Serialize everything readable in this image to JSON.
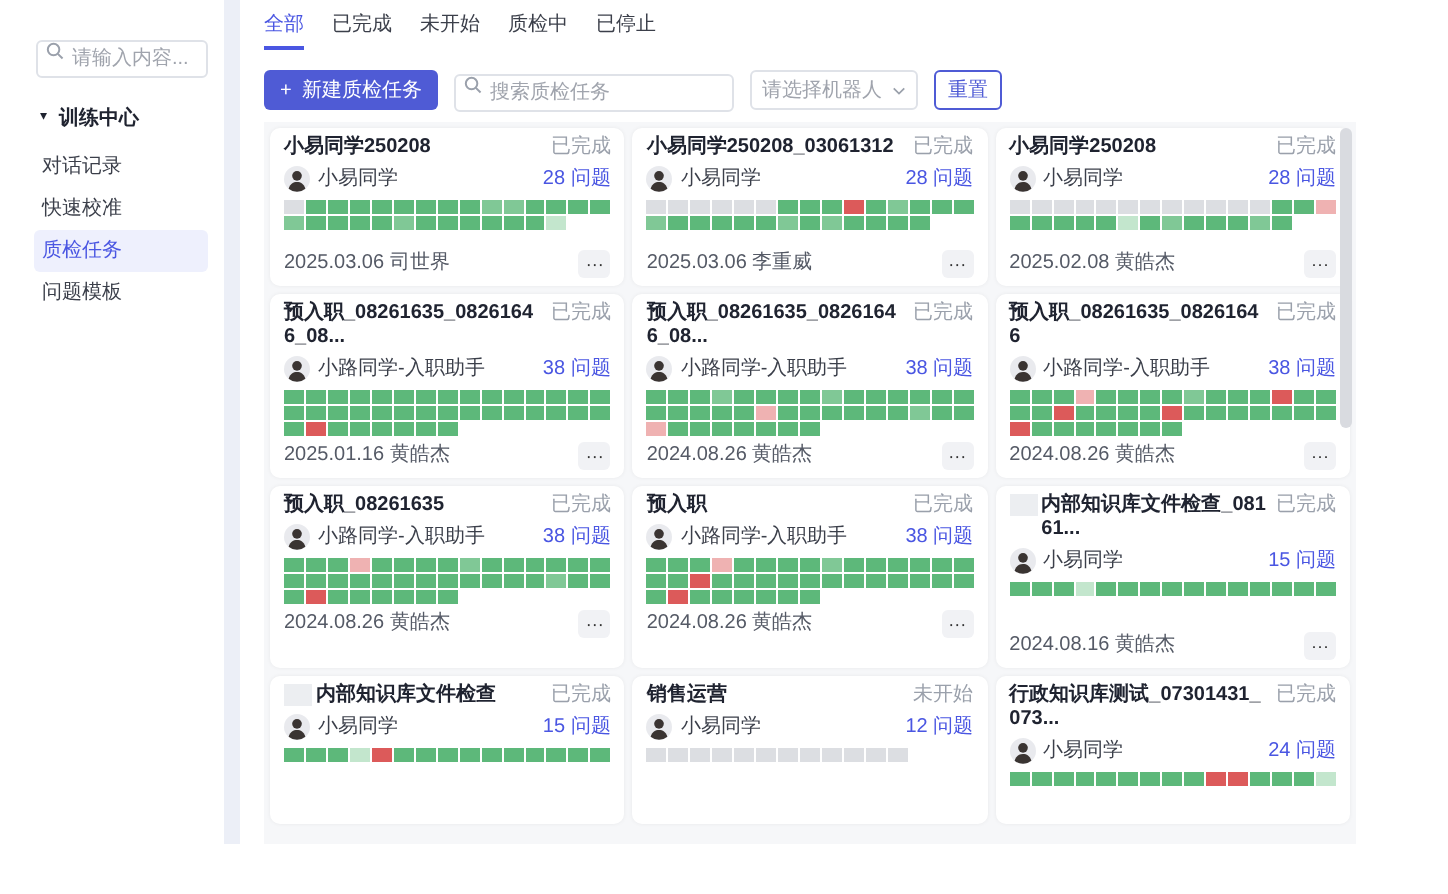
{
  "sidebar": {
    "search": {
      "placeholder": "请输入内容..."
    },
    "group": {
      "icon": "▾",
      "label": "训练中心",
      "expanded": true
    },
    "items": [
      {
        "label": "对话记录",
        "selected": false
      },
      {
        "label": "快速校准",
        "selected": false
      },
      {
        "label": "质检任务",
        "selected": true
      },
      {
        "label": "问题模板",
        "selected": false
      }
    ]
  },
  "tabs": [
    {
      "label": "全部",
      "selected": true
    },
    {
      "label": "已完成",
      "selected": false
    },
    {
      "label": "未开始",
      "selected": false
    },
    {
      "label": "质检中",
      "selected": false
    },
    {
      "label": "已停止",
      "selected": false
    }
  ],
  "toolbar": {
    "new_button": {
      "icon": "+",
      "label": "新建质检任务"
    },
    "search": {
      "placeholder": "搜索质检任务"
    },
    "robot_select": {
      "placeholder": "请选择机器人"
    },
    "reset_button": "重置"
  },
  "cards": [
    {
      "title": "小易同学250208",
      "redacted": false,
      "status": "已完成",
      "user": "小易同学",
      "questions": "28 问题",
      "date": "2025.03.06",
      "owner": "司世界",
      "more": "···",
      "cells": [
        {
          "color": "#dcdee2"
        },
        {
          "color": "#5db87a"
        },
        {
          "color": "#5db87a"
        },
        {
          "color": "#5db87a"
        },
        {
          "color": "#5db87a"
        },
        {
          "color": "#5db87a"
        },
        {
          "color": "#5db87a"
        },
        {
          "color": "#5db87a"
        },
        {
          "color": "#5db87a"
        },
        {
          "color": "#80c896"
        },
        {
          "color": "#80c896"
        },
        {
          "color": "#5db87a"
        },
        {
          "color": "#5db87a"
        },
        {
          "color": "#5db87a"
        },
        {
          "color": "#5db87a"
        },
        {
          "color": "#80c896"
        },
        {
          "color": "#5db87a"
        },
        {
          "color": "#5db87a"
        },
        {
          "color": "#5db87a"
        },
        {
          "color": "#5db87a"
        },
        {
          "color": "#80c896"
        },
        {
          "color": "#5db87a"
        },
        {
          "color": "#5db87a"
        },
        {
          "color": "#5db87a"
        },
        {
          "color": "#5db87a"
        },
        {
          "color": "#5db87a"
        },
        {
          "color": "#5db87a"
        },
        {
          "color": "#c3e6cd"
        }
      ]
    },
    {
      "title": "小易同学250208_03061312",
      "redacted": false,
      "status": "已完成",
      "user": "小易同学",
      "questions": "28 问题",
      "date": "2025.03.06",
      "owner": "李重威",
      "more": "···",
      "cells": [
        {
          "color": "#dcdee2"
        },
        {
          "color": "#dcdee2"
        },
        {
          "color": "#dcdee2"
        },
        {
          "color": "#dcdee2"
        },
        {
          "color": "#dcdee2"
        },
        {
          "color": "#dcdee2"
        },
        {
          "color": "#5db87a"
        },
        {
          "color": "#5db87a"
        },
        {
          "color": "#5db87a"
        },
        {
          "color": "#dc5a5a"
        },
        {
          "color": "#5db87a"
        },
        {
          "color": "#80c896"
        },
        {
          "color": "#5db87a"
        },
        {
          "color": "#5db87a"
        },
        {
          "color": "#5db87a"
        },
        {
          "color": "#80c896"
        },
        {
          "color": "#5db87a"
        },
        {
          "color": "#5db87a"
        },
        {
          "color": "#5db87a"
        },
        {
          "color": "#5db87a"
        },
        {
          "color": "#5db87a"
        },
        {
          "color": "#80c896"
        },
        {
          "color": "#5db87a"
        },
        {
          "color": "#80c896"
        },
        {
          "color": "#5db87a"
        },
        {
          "color": "#5db87a"
        },
        {
          "color": "#5db87a"
        },
        {
          "color": "#5db87a"
        }
      ]
    },
    {
      "title": "小易同学250208",
      "redacted": false,
      "status": "已完成",
      "user": "小易同学",
      "questions": "28 问题",
      "date": "2025.02.08",
      "owner": "黄皓杰",
      "more": "···",
      "cells": [
        {
          "color": "#dcdee2"
        },
        {
          "color": "#dcdee2"
        },
        {
          "color": "#dcdee2"
        },
        {
          "color": "#dcdee2"
        },
        {
          "color": "#dcdee2"
        },
        {
          "color": "#dcdee2"
        },
        {
          "color": "#dcdee2"
        },
        {
          "color": "#dcdee2"
        },
        {
          "color": "#dcdee2"
        },
        {
          "color": "#dcdee2"
        },
        {
          "color": "#dcdee2"
        },
        {
          "color": "#dcdee2"
        },
        {
          "color": "#5db87a"
        },
        {
          "color": "#5db87a"
        },
        {
          "color": "#efb2b2"
        },
        {
          "color": "#5db87a"
        },
        {
          "color": "#5db87a"
        },
        {
          "color": "#5db87a"
        },
        {
          "color": "#5db87a"
        },
        {
          "color": "#5db87a"
        },
        {
          "color": "#c3e6cd"
        },
        {
          "color": "#5db87a"
        },
        {
          "color": "#80c896"
        },
        {
          "color": "#5db87a"
        },
        {
          "color": "#5db87a"
        },
        {
          "color": "#5db87a"
        },
        {
          "color": "#80c896"
        },
        {
          "color": "#5db87a"
        }
      ]
    },
    {
      "title": "预入职_08261635_08261646_08...",
      "redacted": false,
      "status": "已完成",
      "user": "小路同学-入职助手",
      "questions": "38 问题",
      "date": "2025.01.16",
      "owner": "黄皓杰",
      "more": "···",
      "cells": [
        {
          "color": "#5db87a"
        },
        {
          "color": "#5db87a"
        },
        {
          "color": "#5db87a"
        },
        {
          "color": "#5db87a"
        },
        {
          "color": "#5db87a"
        },
        {
          "color": "#5db87a"
        },
        {
          "color": "#5db87a"
        },
        {
          "color": "#5db87a"
        },
        {
          "color": "#5db87a"
        },
        {
          "color": "#5db87a"
        },
        {
          "color": "#5db87a"
        },
        {
          "color": "#5db87a"
        },
        {
          "color": "#5db87a"
        },
        {
          "color": "#5db87a"
        },
        {
          "color": "#5db87a"
        },
        {
          "color": "#5db87a"
        },
        {
          "color": "#5db87a"
        },
        {
          "color": "#5db87a"
        },
        {
          "color": "#5db87a"
        },
        {
          "color": "#5db87a"
        },
        {
          "color": "#5db87a"
        },
        {
          "color": "#5db87a"
        },
        {
          "color": "#5db87a"
        },
        {
          "color": "#5db87a"
        },
        {
          "color": "#5db87a"
        },
        {
          "color": "#5db87a"
        },
        {
          "color": "#5db87a"
        },
        {
          "color": "#5db87a"
        },
        {
          "color": "#5db87a"
        },
        {
          "color": "#5db87a"
        },
        {
          "color": "#5db87a"
        },
        {
          "color": "#dc5a5a"
        },
        {
          "color": "#5db87a"
        },
        {
          "color": "#5db87a"
        },
        {
          "color": "#5db87a"
        },
        {
          "color": "#5db87a"
        },
        {
          "color": "#5db87a"
        },
        {
          "color": "#5db87a"
        }
      ]
    },
    {
      "title": "预入职_08261635_08261646_08...",
      "redacted": false,
      "status": "已完成",
      "user": "小路同学-入职助手",
      "questions": "38 问题",
      "date": "2024.08.26",
      "owner": "黄皓杰",
      "more": "···",
      "cells": [
        {
          "color": "#5db87a"
        },
        {
          "color": "#5db87a"
        },
        {
          "color": "#5db87a"
        },
        {
          "color": "#80c896"
        },
        {
          "color": "#5db87a"
        },
        {
          "color": "#5db87a"
        },
        {
          "color": "#5db87a"
        },
        {
          "color": "#5db87a"
        },
        {
          "color": "#80c896"
        },
        {
          "color": "#5db87a"
        },
        {
          "color": "#5db87a"
        },
        {
          "color": "#5db87a"
        },
        {
          "color": "#5db87a"
        },
        {
          "color": "#5db87a"
        },
        {
          "color": "#5db87a"
        },
        {
          "color": "#5db87a"
        },
        {
          "color": "#5db87a"
        },
        {
          "color": "#5db87a"
        },
        {
          "color": "#5db87a"
        },
        {
          "color": "#5db87a"
        },
        {
          "color": "#efb2b2"
        },
        {
          "color": "#5db87a"
        },
        {
          "color": "#5db87a"
        },
        {
          "color": "#5db87a"
        },
        {
          "color": "#5db87a"
        },
        {
          "color": "#5db87a"
        },
        {
          "color": "#5db87a"
        },
        {
          "color": "#80c896"
        },
        {
          "color": "#5db87a"
        },
        {
          "color": "#5db87a"
        },
        {
          "color": "#efb2b2"
        },
        {
          "color": "#5db87a"
        },
        {
          "color": "#5db87a"
        },
        {
          "color": "#5db87a"
        },
        {
          "color": "#5db87a"
        },
        {
          "color": "#5db87a"
        },
        {
          "color": "#5db87a"
        },
        {
          "color": "#5db87a"
        }
      ]
    },
    {
      "title": "预入职_08261635_08261646",
      "redacted": false,
      "status": "已完成",
      "user": "小路同学-入职助手",
      "questions": "38 问题",
      "date": "2024.08.26",
      "owner": "黄皓杰",
      "more": "···",
      "cells": [
        {
          "color": "#5db87a"
        },
        {
          "color": "#5db87a"
        },
        {
          "color": "#5db87a"
        },
        {
          "color": "#efb2b2"
        },
        {
          "color": "#5db87a"
        },
        {
          "color": "#5db87a"
        },
        {
          "color": "#5db87a"
        },
        {
          "color": "#5db87a"
        },
        {
          "color": "#80c896"
        },
        {
          "color": "#5db87a"
        },
        {
          "color": "#5db87a"
        },
        {
          "color": "#5db87a"
        },
        {
          "color": "#dc5a5a"
        },
        {
          "color": "#5db87a"
        },
        {
          "color": "#5db87a"
        },
        {
          "color": "#5db87a"
        },
        {
          "color": "#5db87a"
        },
        {
          "color": "#dc5a5a"
        },
        {
          "color": "#5db87a"
        },
        {
          "color": "#5db87a"
        },
        {
          "color": "#5db87a"
        },
        {
          "color": "#5db87a"
        },
        {
          "color": "#dc5a5a"
        },
        {
          "color": "#5db87a"
        },
        {
          "color": "#5db87a"
        },
        {
          "color": "#5db87a"
        },
        {
          "color": "#5db87a"
        },
        {
          "color": "#5db87a"
        },
        {
          "color": "#5db87a"
        },
        {
          "color": "#5db87a"
        },
        {
          "color": "#dc5a5a"
        },
        {
          "color": "#5db87a"
        },
        {
          "color": "#5db87a"
        },
        {
          "color": "#5db87a"
        },
        {
          "color": "#5db87a"
        },
        {
          "color": "#5db87a"
        },
        {
          "color": "#5db87a"
        },
        {
          "color": "#5db87a"
        }
      ]
    },
    {
      "title": "预入职_08261635",
      "redacted": false,
      "status": "已完成",
      "user": "小路同学-入职助手",
      "questions": "38 问题",
      "date": "2024.08.26",
      "owner": "黄皓杰",
      "more": "···",
      "cells": [
        {
          "color": "#5db87a"
        },
        {
          "color": "#5db87a"
        },
        {
          "color": "#5db87a"
        },
        {
          "color": "#efb2b2"
        },
        {
          "color": "#5db87a"
        },
        {
          "color": "#5db87a"
        },
        {
          "color": "#5db87a"
        },
        {
          "color": "#5db87a"
        },
        {
          "color": "#80c896"
        },
        {
          "color": "#5db87a"
        },
        {
          "color": "#5db87a"
        },
        {
          "color": "#5db87a"
        },
        {
          "color": "#5db87a"
        },
        {
          "color": "#5db87a"
        },
        {
          "color": "#5db87a"
        },
        {
          "color": "#5db87a"
        },
        {
          "color": "#5db87a"
        },
        {
          "color": "#5db87a"
        },
        {
          "color": "#5db87a"
        },
        {
          "color": "#5db87a"
        },
        {
          "color": "#5db87a"
        },
        {
          "color": "#5db87a"
        },
        {
          "color": "#5db87a"
        },
        {
          "color": "#5db87a"
        },
        {
          "color": "#5db87a"
        },
        {
          "color": "#5db87a"
        },
        {
          "color": "#5db87a"
        },
        {
          "color": "#80c896"
        },
        {
          "color": "#5db87a"
        },
        {
          "color": "#5db87a"
        },
        {
          "color": "#5db87a"
        },
        {
          "color": "#dc5a5a"
        },
        {
          "color": "#5db87a"
        },
        {
          "color": "#5db87a"
        },
        {
          "color": "#5db87a"
        },
        {
          "color": "#5db87a"
        },
        {
          "color": "#5db87a"
        },
        {
          "color": "#5db87a"
        }
      ]
    },
    {
      "title": "预入职",
      "redacted": false,
      "status": "已完成",
      "user": "小路同学-入职助手",
      "questions": "38 问题",
      "date": "2024.08.26",
      "owner": "黄皓杰",
      "more": "···",
      "cells": [
        {
          "color": "#5db87a"
        },
        {
          "color": "#5db87a"
        },
        {
          "color": "#5db87a"
        },
        {
          "color": "#efb2b2"
        },
        {
          "color": "#5db87a"
        },
        {
          "color": "#5db87a"
        },
        {
          "color": "#5db87a"
        },
        {
          "color": "#5db87a"
        },
        {
          "color": "#80c896"
        },
        {
          "color": "#5db87a"
        },
        {
          "color": "#5db87a"
        },
        {
          "color": "#5db87a"
        },
        {
          "color": "#5db87a"
        },
        {
          "color": "#5db87a"
        },
        {
          "color": "#5db87a"
        },
        {
          "color": "#5db87a"
        },
        {
          "color": "#5db87a"
        },
        {
          "color": "#dc5a5a"
        },
        {
          "color": "#5db87a"
        },
        {
          "color": "#5db87a"
        },
        {
          "color": "#5db87a"
        },
        {
          "color": "#5db87a"
        },
        {
          "color": "#5db87a"
        },
        {
          "color": "#5db87a"
        },
        {
          "color": "#5db87a"
        },
        {
          "color": "#5db87a"
        },
        {
          "color": "#5db87a"
        },
        {
          "color": "#5db87a"
        },
        {
          "color": "#5db87a"
        },
        {
          "color": "#5db87a"
        },
        {
          "color": "#5db87a"
        },
        {
          "color": "#dc5a5a"
        },
        {
          "color": "#5db87a"
        },
        {
          "color": "#5db87a"
        },
        {
          "color": "#5db87a"
        },
        {
          "color": "#5db87a"
        },
        {
          "color": "#5db87a"
        },
        {
          "color": "#5db87a"
        }
      ]
    },
    {
      "title": "内部知识库文件检查_08161...",
      "redacted": true,
      "status": "已完成",
      "user": "小易同学",
      "questions": "15 问题",
      "date": "2024.08.16",
      "owner": "黄皓杰",
      "more": "···",
      "cells": [
        {
          "color": "#5db87a"
        },
        {
          "color": "#5db87a"
        },
        {
          "color": "#5db87a"
        },
        {
          "color": "#c3e6cd"
        },
        {
          "color": "#5db87a"
        },
        {
          "color": "#5db87a"
        },
        {
          "color": "#5db87a"
        },
        {
          "color": "#5db87a"
        },
        {
          "color": "#5db87a"
        },
        {
          "color": "#5db87a"
        },
        {
          "color": "#5db87a"
        },
        {
          "color": "#5db87a"
        },
        {
          "color": "#5db87a"
        },
        {
          "color": "#5db87a"
        },
        {
          "color": "#5db87a"
        }
      ]
    },
    {
      "title": "内部知识库文件检查",
      "redacted": true,
      "status": "已完成",
      "user": "小易同学",
      "questions": "15 问题",
      "cells": [
        {
          "color": "#5db87a"
        },
        {
          "color": "#5db87a"
        },
        {
          "color": "#5db87a"
        },
        {
          "color": "#c3e6cd"
        },
        {
          "color": "#dc5a5a"
        },
        {
          "color": "#5db87a"
        },
        {
          "color": "#5db87a"
        },
        {
          "color": "#5db87a"
        },
        {
          "color": "#5db87a"
        },
        {
          "color": "#5db87a"
        },
        {
          "color": "#5db87a"
        },
        {
          "color": "#5db87a"
        },
        {
          "color": "#5db87a"
        },
        {
          "color": "#5db87a"
        },
        {
          "color": "#5db87a"
        }
      ]
    },
    {
      "title": "销售运营",
      "redacted": false,
      "status": "未开始",
      "user": "小易同学",
      "questions": "12 问题",
      "cells": [
        {
          "color": "#dcdee2"
        },
        {
          "color": "#dcdee2"
        },
        {
          "color": "#dcdee2"
        },
        {
          "color": "#dcdee2"
        },
        {
          "color": "#dcdee2"
        },
        {
          "color": "#dcdee2"
        },
        {
          "color": "#dcdee2"
        },
        {
          "color": "#dcdee2"
        },
        {
          "color": "#dcdee2"
        },
        {
          "color": "#dcdee2"
        },
        {
          "color": "#dcdee2"
        },
        {
          "color": "#dcdee2"
        }
      ]
    },
    {
      "title": "行政知识库测试_07301431_073...",
      "redacted": false,
      "status": "已完成",
      "user": "小易同学",
      "questions": "24 问题",
      "cells": [
        {
          "color": "#5db87a"
        },
        {
          "color": "#5db87a"
        },
        {
          "color": "#5db87a"
        },
        {
          "color": "#5db87a"
        },
        {
          "color": "#5db87a"
        },
        {
          "color": "#5db87a"
        },
        {
          "color": "#5db87a"
        },
        {
          "color": "#5db87a"
        },
        {
          "color": "#5db87a"
        },
        {
          "color": "#dc5a5a"
        },
        {
          "color": "#dc5a5a"
        },
        {
          "color": "#5db87a"
        },
        {
          "color": "#5db87a"
        },
        {
          "color": "#5db87a"
        },
        {
          "color": "#c3e6cd"
        }
      ]
    }
  ]
}
